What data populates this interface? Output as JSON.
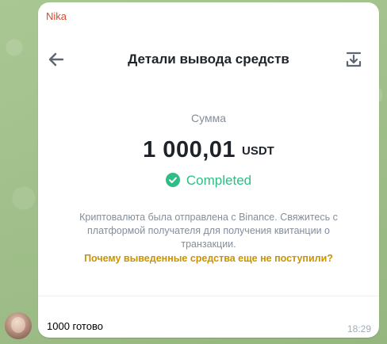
{
  "message": {
    "sender_name": "Nika",
    "text": "1000 готово",
    "time": "18:29"
  },
  "card": {
    "title": "Детали вывода средств",
    "amount_label": "Сумма",
    "amount_value": "1 000,01",
    "currency": "USDT",
    "status": "Completed",
    "info_text": "Криптовалюта была отправлена с Binance. Свяжитесь с платформой получателя для получения квитанции о транзакции.",
    "help_link": "Почему выведенные средства еще не поступили?"
  },
  "colors": {
    "sender": "#d64a2c",
    "status_green": "#2ebd85",
    "link_yellow": "#c99400",
    "muted_text": "#848e9c",
    "primary_text": "#1e2329"
  },
  "icons": {
    "back": "arrow-left-icon",
    "download": "download-icon",
    "status": "check-circle-icon"
  }
}
